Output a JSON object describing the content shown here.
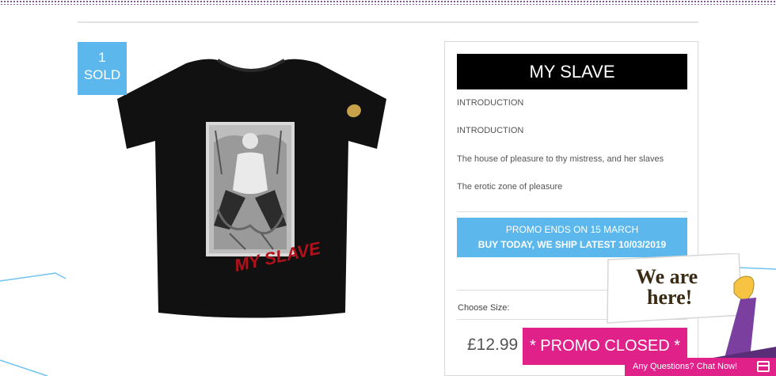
{
  "badge": {
    "count": "1",
    "label": "SOLD"
  },
  "product": {
    "title": "MY SLAVE",
    "print_text": "MY SLAVE",
    "descriptions": [
      "INTRODUCTION",
      "INTRODUCTION",
      "The house of pleasure to thy mistress, and her slaves",
      "The erotic zone of pleasure"
    ],
    "promo_line1": "PROMO ENDS ON 15 MARCH",
    "promo_line2": "BUY TODAY, WE SHIP LATEST 10/03/2019",
    "size_label": "Choose Size:",
    "price": "£12.99",
    "buy_button": "* PROMO CLOSED *"
  },
  "chat": {
    "sign_line1": "We are",
    "sign_line2": "here!",
    "bar_label": "Any Questions? Chat Now!"
  },
  "colors": {
    "accent_blue": "#5cb8ec",
    "accent_pink": "#e0218a",
    "shirt": "#111111",
    "print_red": "#b0121b"
  }
}
